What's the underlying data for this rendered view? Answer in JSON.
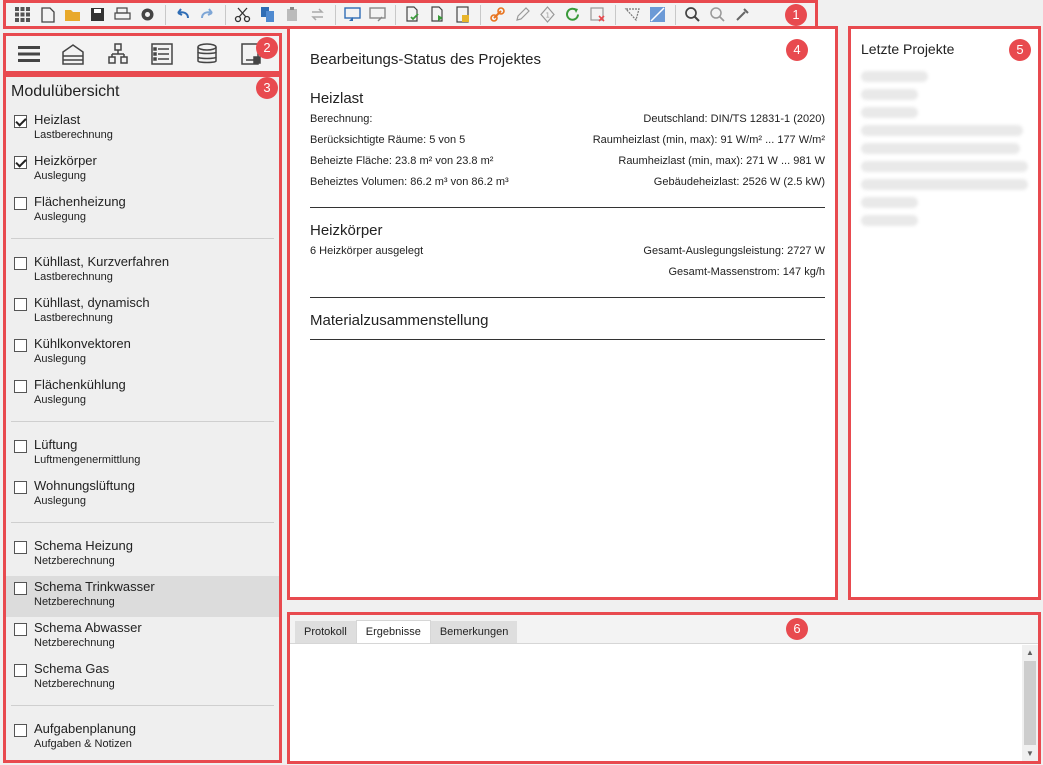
{
  "badges": [
    "1",
    "2",
    "3",
    "4",
    "5",
    "6"
  ],
  "toolbar": {
    "buttons": [
      {
        "name": "apps-grid-icon"
      },
      {
        "name": "new-file-icon"
      },
      {
        "name": "open-folder-icon"
      },
      {
        "name": "save-icon"
      },
      {
        "name": "print-icon"
      },
      {
        "name": "settings-gear-icon"
      },
      {
        "name": "undo-icon"
      },
      {
        "name": "redo-icon"
      },
      {
        "name": "cut-icon"
      },
      {
        "name": "copy-icon"
      },
      {
        "name": "paste-icon"
      },
      {
        "name": "replace-icon"
      },
      {
        "name": "import-icon"
      },
      {
        "name": "export-icon"
      },
      {
        "name": "document-check-icon"
      },
      {
        "name": "document-forward-icon"
      },
      {
        "name": "calculator-icon"
      },
      {
        "name": "link-icon"
      },
      {
        "name": "pencil-icon"
      },
      {
        "name": "info-icon"
      },
      {
        "name": "refresh-icon"
      },
      {
        "name": "delete-icon"
      },
      {
        "name": "ruler-icon"
      },
      {
        "name": "image-icon"
      },
      {
        "name": "search-icon"
      },
      {
        "name": "search-clear-icon"
      },
      {
        "name": "eyedropper-icon"
      }
    ]
  },
  "modules": {
    "title": "Modulübersicht",
    "groups": [
      [
        {
          "label": "Heizlast",
          "sub": "Lastberechnung",
          "checked": true
        },
        {
          "label": "Heizkörper",
          "sub": "Auslegung",
          "checked": true
        },
        {
          "label": "Flächenheizung",
          "sub": "Auslegung",
          "checked": false
        }
      ],
      [
        {
          "label": "Kühllast, Kurzverfahren",
          "sub": "Lastberechnung",
          "checked": false
        },
        {
          "label": "Kühllast, dynamisch",
          "sub": "Lastberechnung",
          "checked": false
        },
        {
          "label": "Kühlkonvektoren",
          "sub": "Auslegung",
          "checked": false
        },
        {
          "label": "Flächenkühlung",
          "sub": "Auslegung",
          "checked": false
        }
      ],
      [
        {
          "label": "Lüftung",
          "sub": "Luftmengenermittlung",
          "checked": false
        },
        {
          "label": "Wohnungslüftung",
          "sub": "Auslegung",
          "checked": false
        }
      ],
      [
        {
          "label": "Schema Heizung",
          "sub": "Netzberechnung",
          "checked": false
        },
        {
          "label": "Schema Trinkwasser",
          "sub": "Netzberechnung",
          "checked": false,
          "highlight": true
        },
        {
          "label": "Schema Abwasser",
          "sub": "Netzberechnung",
          "checked": false
        },
        {
          "label": "Schema Gas",
          "sub": "Netzberechnung",
          "checked": false
        }
      ],
      [
        {
          "label": "Aufgabenplanung",
          "sub": "Aufgaben & Notizen",
          "checked": false
        }
      ]
    ]
  },
  "status": {
    "title": "Bearbeitungs-Status des Projektes",
    "heizlast": {
      "heading": "Heizlast",
      "rows": [
        [
          "Berechnung:",
          "Deutschland: DIN/TS 12831-1 (2020)"
        ],
        [
          "Berücksichtigte Räume: 5 von 5",
          "Raumheizlast (min, max): 91 W/m² ... 177 W/m²"
        ],
        [
          "Beheizte Fläche: 23.8 m² von 23.8 m²",
          "Raumheizlast (min, max): 271 W ... 981 W"
        ],
        [
          "Beheiztes Volumen: 86.2 m³ von 86.2 m³",
          "Gebäudeheizlast: 2526 W (2.5 kW)"
        ]
      ]
    },
    "heizkoerper": {
      "heading": "Heizkörper",
      "rows": [
        [
          "6 Heizkörper ausgelegt",
          "Gesamt-Auslegungsleistung: 2727 W"
        ],
        [
          "",
          "Gesamt-Massenstrom: 147 kg/h"
        ]
      ]
    },
    "material": {
      "heading": "Materialzusammenstellung"
    }
  },
  "recent": {
    "title": "Letzte Projekte",
    "item_count_blurred": 9
  },
  "bottom": {
    "tabs": [
      "Protokoll",
      "Ergebnisse",
      "Bemerkungen"
    ],
    "active_tab": "Ergebnisse"
  },
  "colors": {
    "accent_red": "#e84a4f",
    "icon_blue": "#2f6db5",
    "icon_orange": "#e8931e",
    "icon_green": "#3a9a3a"
  }
}
